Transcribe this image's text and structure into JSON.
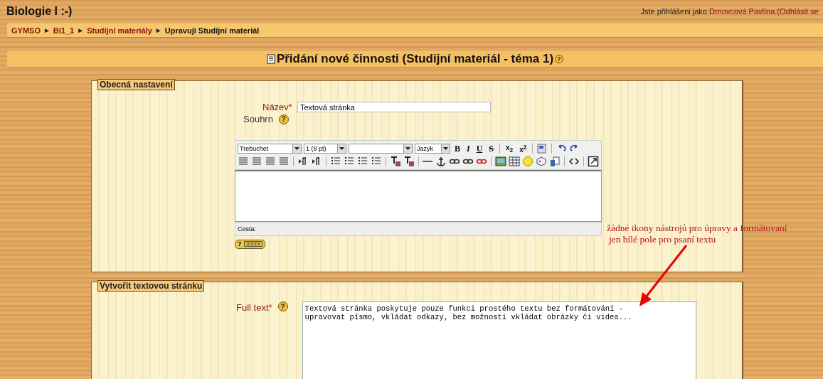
{
  "site_title": "Biologie I :-)",
  "login": {
    "prefix": "Jste přihlášeni jako",
    "user": "Drnovcová Pavlína",
    "logout": "(Odhlásit se"
  },
  "breadcrumb": [
    {
      "label": "GYMSO",
      "link": true
    },
    {
      "label": "Bi1_1",
      "link": true,
      "before": "►"
    },
    {
      "label": "Studijní materiály",
      "link": true,
      "before": "►"
    },
    {
      "label": "Upravuji Studijní materiál",
      "link": false,
      "before": "►"
    }
  ],
  "heading": {
    "text": "Přidání nové činnosti (Studijní materiál - téma 1)",
    "help": "?"
  },
  "general": {
    "legend": "Obecná nastavení",
    "name": {
      "label": "Název",
      "required": "*",
      "value": "Textová stránka"
    },
    "summary": {
      "label": "Souhrn",
      "help": "?"
    },
    "editor": {
      "selects": [
        {
          "value": "Trebuchet"
        },
        {
          "value": "1 (8 pt)"
        },
        {
          "value": "Jazyk"
        }
      ],
      "format_buttons": [
        "B",
        "I",
        "U",
        "S"
      ],
      "script_buttons": [
        "x$_{2}$",
        "x$^{2}$"
      ],
      "path_label": "Cesta:",
      "keyboard_help": "?"
    }
  },
  "text_page": {
    "legend": "Vytvořit textovou stránku",
    "full_text": {
      "label": "Full text",
      "required": "*",
      "help": "?",
      "value": "Textová stránka poskytuje pouze funkci prostého textu bez formátování -\nupravovat písmo, vkládat odkazy, bez možnosti vkládat obrázky či videa..."
    }
  },
  "annotation": {
    "lines": [
      "žádné ikony nástrojů pro úpravy a formátovaní",
      "jen bílé pole pro psaní textu"
    ]
  }
}
